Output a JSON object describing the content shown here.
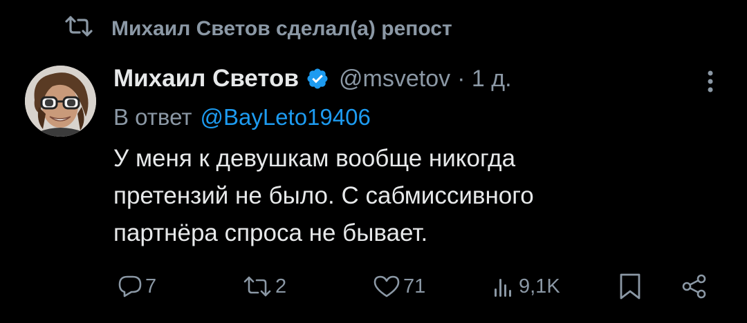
{
  "repost": {
    "icon": "repost-icon",
    "text": "Михаил Светов сделал(а) репост"
  },
  "tweet": {
    "author_name": "Михаил Светов",
    "verified": true,
    "verified_color": "#1d9bf0",
    "handle": "@msvetov",
    "time": "· 1 д.",
    "reply_prefix": "В ответ",
    "reply_mention": "@BayLeto19406",
    "text_lines": [
      "У меня к девушкам вообще никогда",
      "претензий не было. С сабмиссивного",
      "партнёра спроса не бывает."
    ]
  },
  "actions": {
    "reply": {
      "icon": "reply-icon",
      "count": "7"
    },
    "repost": {
      "icon": "repost-icon",
      "count": "2"
    },
    "like": {
      "icon": "heart-icon",
      "count": "71"
    },
    "views": {
      "icon": "views-icon",
      "count": "9,1K"
    },
    "bookmark": {
      "icon": "bookmark-icon"
    },
    "share": {
      "icon": "share-icon"
    }
  },
  "colors": {
    "background": "#000000",
    "text": "#e7e9ea",
    "muted": "#8b98a5",
    "link": "#1d9bf0"
  }
}
